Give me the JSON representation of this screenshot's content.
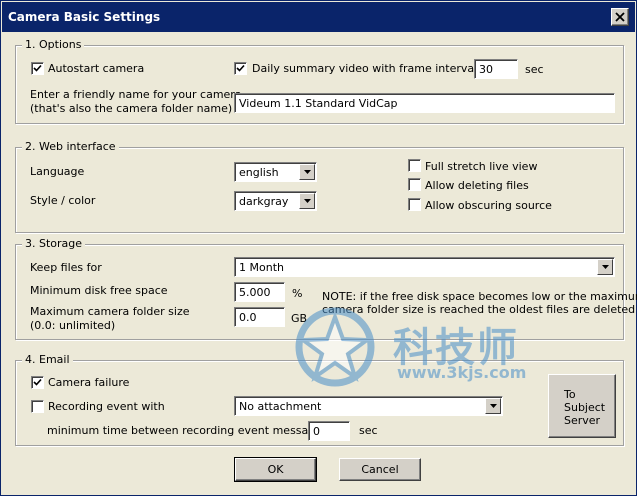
{
  "window": {
    "title": "Camera Basic Settings",
    "close_icon": "close-icon"
  },
  "options": {
    "legend": "1. Options",
    "autostart": {
      "label": "Autostart camera",
      "checked": true
    },
    "daily_summary": {
      "label": "Daily summary video with frame interval of",
      "checked": true,
      "value": "30",
      "unit": "sec"
    },
    "friendly_name_label_1": "Enter a friendly name for your camera",
    "friendly_name_label_2": "(that's also the camera folder name)",
    "friendly_name_value": "Videum 1.1 Standard VidCap"
  },
  "web": {
    "legend": "2. Web interface",
    "language_label": "Language",
    "language_value": "english",
    "style_label": "Style / color",
    "style_value": "darkgray",
    "full_stretch": {
      "label": "Full stretch live view",
      "checked": false
    },
    "allow_deleting": {
      "label": "Allow deleting files",
      "checked": false
    },
    "allow_obscuring": {
      "label": "Allow obscuring source",
      "checked": false
    }
  },
  "storage": {
    "legend": "3. Storage",
    "keep_label": "Keep files for",
    "keep_value": "1 Month",
    "min_disk_label": "Minimum disk free space",
    "min_disk_value": "5.000",
    "min_disk_unit": "%",
    "max_folder_label_1": "Maximum camera folder size",
    "max_folder_label_2": "(0.0: unlimited)",
    "max_folder_value": "0.0",
    "max_folder_unit": "GB",
    "note_1": "NOTE: if the free disk space becomes low or the maximum",
    "note_2": "camera folder size is reached the oldest files are deleted"
  },
  "email": {
    "legend": "4. Email",
    "camera_failure": {
      "label": "Camera failure",
      "checked": true
    },
    "recording_event": {
      "label": "Recording event with",
      "checked": false
    },
    "attachment_value": "No attachment",
    "min_time_label": "minimum time between recording event messages",
    "min_time_value": "0",
    "min_time_unit": "sec",
    "to_subject_server": [
      "To",
      "Subject",
      "Server"
    ]
  },
  "buttons": {
    "ok": "OK",
    "cancel": "Cancel"
  },
  "watermark": {
    "text_cn": "科技师",
    "url": "www.3kjs.com",
    "color": "#4a8fc9"
  }
}
